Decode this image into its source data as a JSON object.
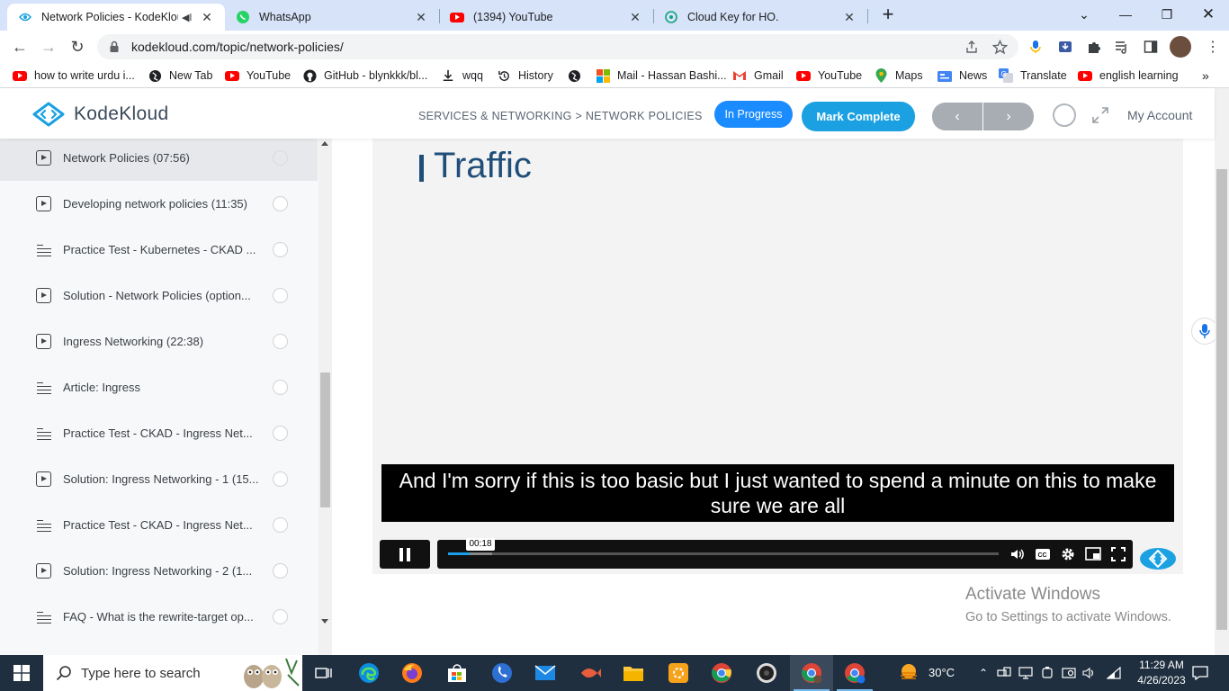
{
  "browser": {
    "tabs": [
      {
        "title": "Network Policies - KodeKloud",
        "active": true,
        "icon": "kodekloud-icon"
      },
      {
        "title": "WhatsApp",
        "active": false,
        "icon": "whatsapp-icon"
      },
      {
        "title": "(1394) YouTube",
        "active": false,
        "icon": "youtube-icon"
      },
      {
        "title": "Cloud Key for HO.",
        "active": false,
        "icon": "chatgpt-icon"
      }
    ],
    "url": "kodekloud.com/topic/network-policies/",
    "bookmarks": [
      {
        "label": "how to write urdu i...",
        "icon": "youtube-icon"
      },
      {
        "label": "New Tab",
        "icon": "globe-icon"
      },
      {
        "label": "YouTube",
        "icon": "youtube-icon"
      },
      {
        "label": "GitHub - blynkkk/bl...",
        "icon": "github-icon"
      },
      {
        "label": "wqq",
        "icon": "download-icon"
      },
      {
        "label": "History",
        "icon": "history-icon"
      },
      {
        "label": "",
        "icon": "globe-icon"
      },
      {
        "label": "Mail - Hassan Bashi...",
        "icon": "microsoft-icon"
      },
      {
        "label": "Gmail",
        "icon": "gmail-icon"
      },
      {
        "label": "YouTube",
        "icon": "youtube-icon"
      },
      {
        "label": "Maps",
        "icon": "maps-icon"
      },
      {
        "label": "News",
        "icon": "news-icon"
      },
      {
        "label": "Translate",
        "icon": "translate-icon"
      },
      {
        "label": "english learning",
        "icon": "youtube-icon"
      }
    ]
  },
  "header": {
    "logo": "KodeKloud",
    "breadcrumb": "SERVICES & NETWORKING > NETWORK POLICIES",
    "status_label": "In Progress",
    "complete_label": "Mark Complete",
    "prev_label": "‹",
    "next_label": "›",
    "account_label": "My Account"
  },
  "sidebar": {
    "lessons": [
      {
        "title": "Network Policies (07:56)",
        "type": "video",
        "current": true
      },
      {
        "title": "Developing network policies (11:35)",
        "type": "video",
        "current": false
      },
      {
        "title": "Practice Test - Kubernetes - CKAD ...",
        "type": "text",
        "current": false
      },
      {
        "title": "Solution - Network Policies (option...",
        "type": "video",
        "current": false
      },
      {
        "title": "Ingress Networking (22:38)",
        "type": "video",
        "current": false
      },
      {
        "title": "Article: Ingress",
        "type": "text",
        "current": false
      },
      {
        "title": "Practice Test - CKAD - Ingress Net...",
        "type": "text",
        "current": false
      },
      {
        "title": "Solution: Ingress Networking - 1 (15...",
        "type": "video",
        "current": false
      },
      {
        "title": "Practice Test - CKAD - Ingress Net...",
        "type": "text",
        "current": false
      },
      {
        "title": "Solution: Ingress Networking - 2 (1...",
        "type": "video",
        "current": false
      },
      {
        "title": "FAQ - What is the rewrite-target op...",
        "type": "text",
        "current": false
      }
    ]
  },
  "video": {
    "slide_title": "Traffic",
    "caption": "And I'm sorry if this is too basic but I just wanted to spend a minute on this to make sure we are all",
    "time_tooltip": "00:18",
    "played_fraction": 0.04,
    "buffered_fraction": 0.08,
    "accent": "#1a9fe8"
  },
  "watermark": {
    "line1": "Activate Windows",
    "line2": "Go to Settings to activate Windows."
  },
  "taskbar": {
    "search_placeholder": "Type here to search",
    "weather": "30°C",
    "time": "11:29 AM",
    "date": "4/26/2023"
  }
}
